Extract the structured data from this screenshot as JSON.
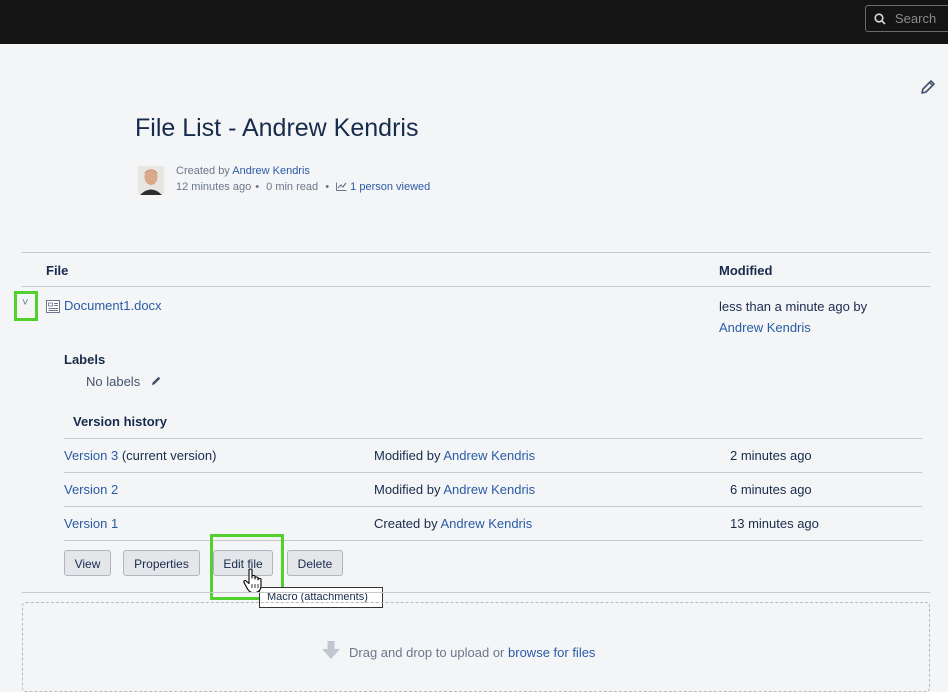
{
  "topbar": {
    "search_placeholder": "Search"
  },
  "page": {
    "title": "File List - Andrew Kendris",
    "byline_prefix": "Created by",
    "author": "Andrew Kendris",
    "created_ago": "12 minutes ago",
    "read_time": "0 min read",
    "views": "1 person viewed",
    "sep": "•"
  },
  "table": {
    "col_file": "File",
    "col_modified": "Modified",
    "file_name": "Document1.docx",
    "modified_text": "less than a minute ago by",
    "modified_by": "Andrew Kendris",
    "expand_glyph": "˅"
  },
  "labels": {
    "heading": "Labels",
    "none": "No labels"
  },
  "versions": {
    "heading": "Version history",
    "rows": [
      {
        "version": "Version 3",
        "note": "(current version)",
        "action": "Modified by",
        "user": "Andrew Kendris",
        "time": "2 minutes ago"
      },
      {
        "version": "Version 2",
        "note": "",
        "action": "Modified by",
        "user": "Andrew Kendris",
        "time": "6 minutes ago"
      },
      {
        "version": "Version 1",
        "note": "",
        "action": "Created by",
        "user": "Andrew Kendris",
        "time": "13 minutes ago"
      }
    ]
  },
  "buttons": {
    "view": "View",
    "properties": "Properties",
    "edit": "Edit file",
    "delete": "Delete"
  },
  "tooltip": "Macro (attachments)",
  "dropzone": {
    "text": "Drag and drop to upload or",
    "link": "browse for files"
  },
  "colors": {
    "highlight": "#52d12e",
    "link": "#2a5ba6",
    "topbar": "#141414"
  },
  "icons": [
    "search-icon",
    "pencil-icon",
    "chart-icon",
    "file-icon",
    "chevron-down-icon",
    "hand-cursor-icon",
    "upload-arrow-icon"
  ]
}
